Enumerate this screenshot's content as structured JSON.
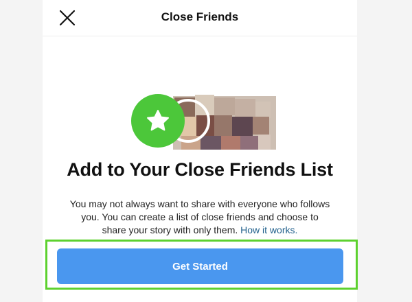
{
  "header": {
    "title": "Close Friends",
    "close_icon": "close-icon"
  },
  "main": {
    "heading": "Add to Your Close Friends List",
    "description_line1": "You may not always want to share with everyone who follows",
    "description_line2": "you. You can create a list of close friends and choose to",
    "description_line3": "share your story with only them.",
    "link_text": "How it works.",
    "badge_icon": "star-icon",
    "avatars": "pixelated-friend-avatars"
  },
  "actions": {
    "cta_label": "Get Started"
  },
  "colors": {
    "accent_green": "#4cc73a",
    "button_blue": "#4a97ef",
    "highlight_green": "#5dd12f",
    "link_blue": "#1f5f8b"
  }
}
